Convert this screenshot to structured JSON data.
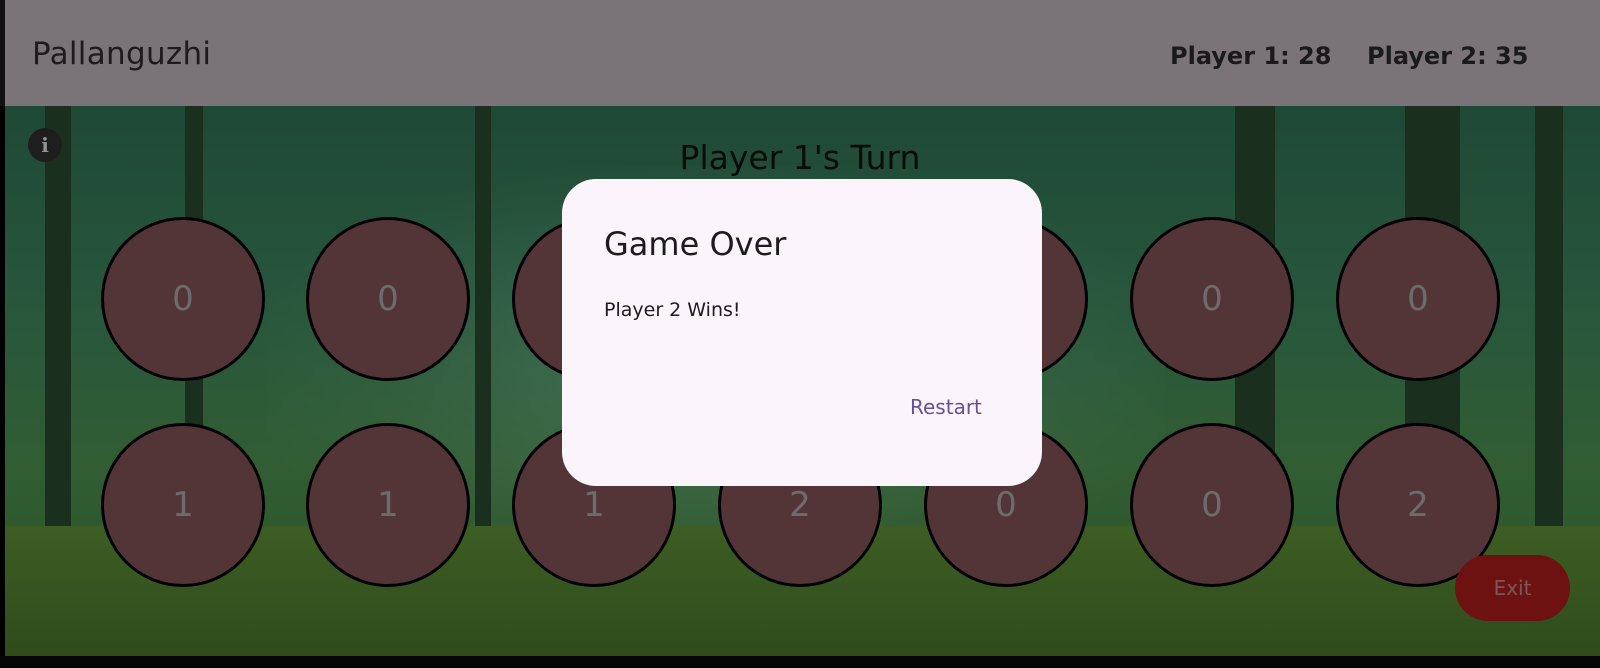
{
  "app": {
    "title": "Pallanguzhi"
  },
  "scores": {
    "player1": "Player 1: 28",
    "player2": "Player 2: 35"
  },
  "turn_label": "Player 1's Turn",
  "info_icon": {
    "name": "info-icon",
    "glyph": "i"
  },
  "board": {
    "top_row": [
      "0",
      "0",
      "",
      "",
      "",
      "0",
      "0"
    ],
    "bottom_row": [
      "1",
      "1",
      "1",
      "2",
      "0",
      "0",
      "2"
    ]
  },
  "exit_label": "Exit",
  "dialog": {
    "title": "Game Over",
    "message": "Player 2 Wins!",
    "action_label": "Restart"
  },
  "colors": {
    "pit": "#7d4f52",
    "exit": "#a31a1a",
    "dialog_bg": "#fbf5fb",
    "action": "#674f9e",
    "topbar": "#7a7478"
  }
}
